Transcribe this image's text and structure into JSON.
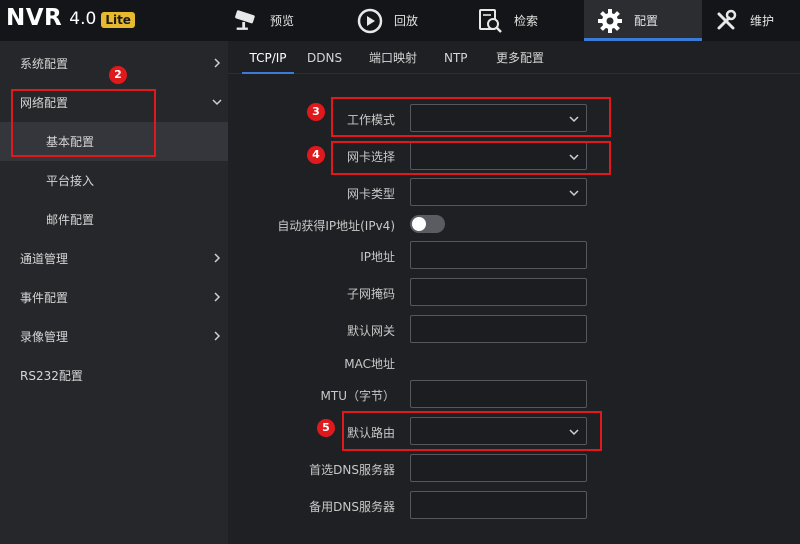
{
  "header": {
    "logo": {
      "main": "NVR",
      "version": "4.0",
      "badge": "Lite"
    },
    "nav": [
      {
        "label": "预览",
        "icon": "camera-icon"
      },
      {
        "label": "回放",
        "icon": "playback-icon"
      },
      {
        "label": "检索",
        "icon": "search-file-icon"
      },
      {
        "label": "配置",
        "icon": "gear-icon",
        "active": true
      },
      {
        "label": "维护",
        "icon": "wrench-icon"
      }
    ]
  },
  "sidebar": {
    "items": [
      {
        "label": "系统配置",
        "arrow": "chevron-right-icon"
      },
      {
        "label": "网络配置",
        "arrow": "chevron-down-icon",
        "expanded": true
      },
      {
        "label": "基本配置",
        "selected": true
      },
      {
        "label": "平台接入"
      },
      {
        "label": "邮件配置"
      },
      {
        "label": "通道管理",
        "arrow": "chevron-right-icon"
      },
      {
        "label": "事件配置",
        "arrow": "chevron-right-icon"
      },
      {
        "label": "录像管理",
        "arrow": "chevron-right-icon"
      },
      {
        "label": "RS232配置"
      }
    ]
  },
  "tabs": [
    {
      "label": "TCP/IP",
      "active": true
    },
    {
      "label": "DDNS"
    },
    {
      "label": "端口映射"
    },
    {
      "label": "NTP"
    },
    {
      "label": "更多配置"
    }
  ],
  "form": {
    "work_mode": {
      "label": "工作模式",
      "value": ""
    },
    "nic_select": {
      "label": "网卡选择",
      "value": ""
    },
    "nic_type": {
      "label": "网卡类型",
      "value": ""
    },
    "dhcp": {
      "label": "自动获得IP地址(IPv4)",
      "enabled": false
    },
    "ip": {
      "label": "IP地址",
      "value": ""
    },
    "subnet": {
      "label": "子网掩码",
      "value": ""
    },
    "gateway": {
      "label": "默认网关",
      "value": ""
    },
    "mac": {
      "label": "MAC地址",
      "value": ""
    },
    "mtu": {
      "label": "MTU（字节）",
      "value": ""
    },
    "default_route": {
      "label": "默认路由",
      "value": ""
    },
    "dns1": {
      "label": "首选DNS服务器",
      "value": ""
    },
    "dns2": {
      "label": "备用DNS服务器",
      "value": ""
    }
  },
  "annotations": {
    "colors": {
      "highlight": "#e0191d"
    },
    "badges": [
      "2",
      "3",
      "4",
      "5"
    ]
  },
  "colors": {
    "accent": "#3a7bd5",
    "logo_badge": "#e6b92e"
  }
}
